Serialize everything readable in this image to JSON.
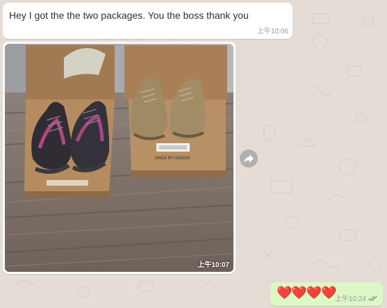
{
  "messages": {
    "incoming_text": {
      "text": "Hey I got the the two packages. You the boss thank you",
      "time": "上午10:06"
    },
    "incoming_image": {
      "time": "上午10:07",
      "box_label": "MADE BY ADIDAS"
    },
    "outgoing": {
      "text": "❤️❤️❤️❤️",
      "time": "上午10:24",
      "status_icon": "double-check-icon"
    }
  },
  "colors": {
    "chat_background": "#e5ddd5",
    "incoming_bubble": "#ffffff",
    "outgoing_bubble": "#dcf8c6",
    "tick_color": "#8a8a8a"
  },
  "icons": {
    "forward": "forward-arrow-icon"
  }
}
